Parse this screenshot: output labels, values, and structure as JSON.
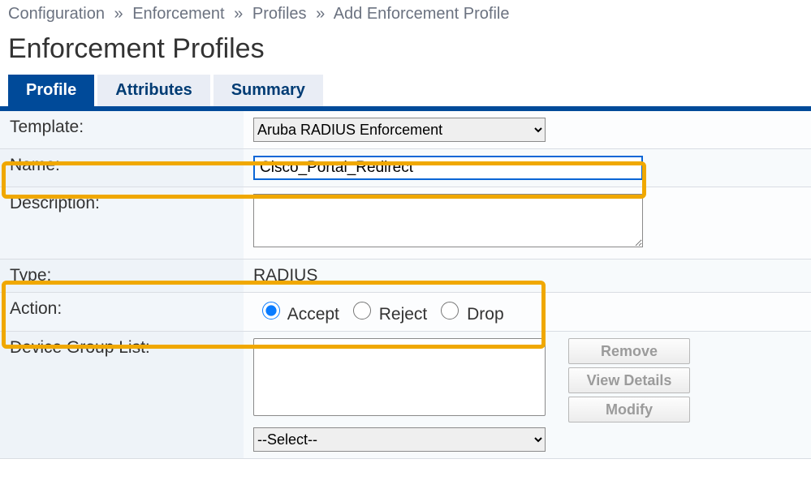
{
  "breadcrumb": {
    "items": [
      "Configuration",
      "Enforcement",
      "Profiles",
      "Add Enforcement Profile"
    ],
    "sep": "»"
  },
  "title": "Enforcement Profiles",
  "tabs": {
    "profile": "Profile",
    "attributes": "Attributes",
    "summary": "Summary"
  },
  "form": {
    "template_label": "Template:",
    "template_value": "Aruba RADIUS Enforcement",
    "name_label": "Name:",
    "name_value": "Cisco_Portal_Redirect",
    "description_label": "Description:",
    "description_value": "",
    "type_label": "Type:",
    "type_value": "RADIUS",
    "action_label": "Action:",
    "action_accept": "Accept",
    "action_reject": "Reject",
    "action_drop": "Drop",
    "dgl_label": "Device Group List:",
    "dgl_select_placeholder": "--Select--",
    "btn_remove": "Remove",
    "btn_view": "View Details",
    "btn_modify": "Modify"
  }
}
